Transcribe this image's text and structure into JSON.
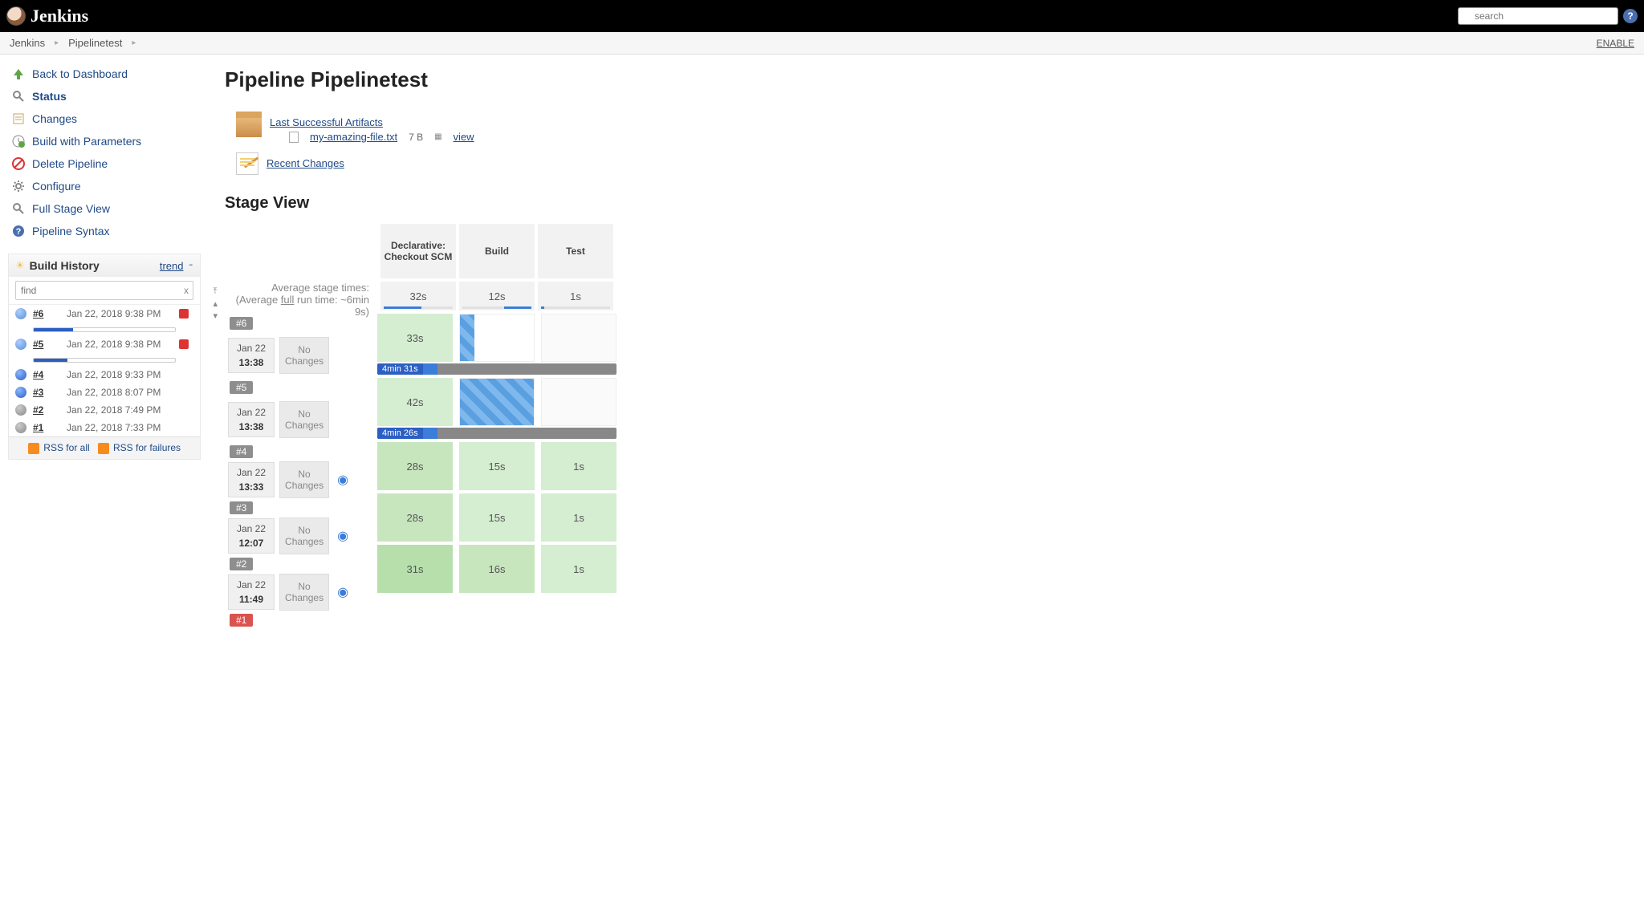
{
  "header": {
    "logo_text": "Jenkins",
    "search_placeholder": "search",
    "enable_link": "ENABLE"
  },
  "breadcrumb": {
    "items": [
      "Jenkins",
      "Pipelinetest"
    ]
  },
  "sidebar": {
    "links": [
      {
        "label": "Back to Dashboard",
        "icon": "up-arrow"
      },
      {
        "label": "Status",
        "icon": "magnifier",
        "bold": true
      },
      {
        "label": "Changes",
        "icon": "notepad"
      },
      {
        "label": "Build with Parameters",
        "icon": "clock-green"
      },
      {
        "label": "Delete Pipeline",
        "icon": "no-entry"
      },
      {
        "label": "Configure",
        "icon": "gear"
      },
      {
        "label": "Full Stage View",
        "icon": "magnifier"
      },
      {
        "label": "Pipeline Syntax",
        "icon": "help"
      }
    ]
  },
  "build_history": {
    "title": "Build History",
    "trend": "trend",
    "find_placeholder": "find",
    "builds": [
      {
        "num": "#6",
        "date": "Jan 22, 2018 9:38 PM",
        "ball": "anim",
        "progress": 28,
        "cancel": true
      },
      {
        "num": "#5",
        "date": "Jan 22, 2018 9:38 PM",
        "ball": "anim",
        "progress": 24,
        "cancel": true
      },
      {
        "num": "#4",
        "date": "Jan 22, 2018 9:33 PM",
        "ball": "blue"
      },
      {
        "num": "#3",
        "date": "Jan 22, 2018 8:07 PM",
        "ball": "blue"
      },
      {
        "num": "#2",
        "date": "Jan 22, 2018 7:49 PM",
        "ball": "grey"
      },
      {
        "num": "#1",
        "date": "Jan 22, 2018 7:33 PM",
        "ball": "grey"
      }
    ],
    "rss_all": "RSS for all",
    "rss_fail": "RSS for failures"
  },
  "main": {
    "title": "Pipeline Pipelinetest",
    "artifacts": {
      "heading": "Last Successful Artifacts",
      "file": "my-amazing-file.txt",
      "size": "7 B",
      "view": "view"
    },
    "recent_changes": "Recent Changes",
    "stage_view_title": "Stage View",
    "avg_label_1": "Average stage times:",
    "avg_label_2a": "(Average ",
    "avg_label_2b": "full",
    "avg_label_2c": " run time: ~6min 9s)",
    "stages": [
      "Declarative: Checkout SCM",
      "Build",
      "Test"
    ],
    "avg_times": [
      "32s",
      "12s",
      "1s"
    ],
    "runs": [
      {
        "badge": "#6",
        "date": "Jan 22",
        "time": "13:38",
        "nochanges": "No Changes",
        "cells": [
          {
            "t": "33s",
            "cls": "sc-green-light"
          },
          {
            "t": "",
            "cls": "sc-running",
            "stripe": "narrow"
          },
          {
            "t": "",
            "cls": "sc-empty"
          }
        ],
        "progress": "4min 31s"
      },
      {
        "badge": "#5",
        "date": "Jan 22",
        "time": "13:38",
        "nochanges": "No Changes",
        "cells": [
          {
            "t": "42s",
            "cls": "sc-green-light"
          },
          {
            "t": "",
            "cls": "sc-running",
            "stripe": "full"
          },
          {
            "t": "",
            "cls": "sc-empty"
          }
        ],
        "progress": "4min 26s"
      },
      {
        "badge": "#4",
        "date": "Jan 22",
        "time": "13:33",
        "nochanges": "No Changes",
        "status": true,
        "cells": [
          {
            "t": "28s",
            "cls": "sc-green-med"
          },
          {
            "t": "15s",
            "cls": "sc-green-light"
          },
          {
            "t": "1s",
            "cls": "sc-green-light"
          }
        ]
      },
      {
        "badge": "#3",
        "date": "Jan 22",
        "time": "12:07",
        "nochanges": "No Changes",
        "status": true,
        "cells": [
          {
            "t": "28s",
            "cls": "sc-green-med"
          },
          {
            "t": "15s",
            "cls": "sc-green-light"
          },
          {
            "t": "1s",
            "cls": "sc-green-light"
          }
        ]
      },
      {
        "badge": "#2",
        "date": "Jan 22",
        "time": "11:49",
        "nochanges": "No Changes",
        "status": true,
        "cells": [
          {
            "t": "31s",
            "cls": "sc-green-dark"
          },
          {
            "t": "16s",
            "cls": "sc-green-med"
          },
          {
            "t": "1s",
            "cls": "sc-green-light"
          }
        ]
      },
      {
        "badge": "#1",
        "red": true
      }
    ]
  }
}
